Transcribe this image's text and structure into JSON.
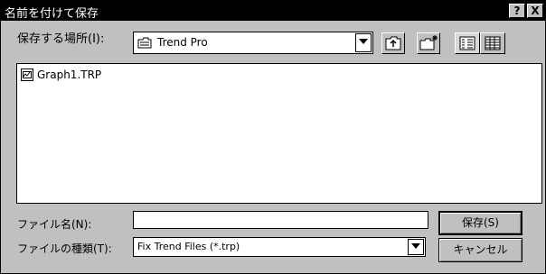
{
  "dialog": {
    "title": "名前を付けて保存",
    "help_label": "?",
    "close_label": "X"
  },
  "lookin": {
    "label": "保存する場所(I):",
    "value": "Trend Pro"
  },
  "toolbar": {
    "icons": [
      "up-one-level-icon",
      "create-new-folder-icon",
      "list-view-icon",
      "details-view-icon"
    ]
  },
  "files": [
    {
      "name": "Graph1.TRP",
      "icon": "trp-file-icon"
    }
  ],
  "filename": {
    "label": "ファイル名(N):",
    "value": ""
  },
  "filetype": {
    "label": "ファイルの種類(T):",
    "value": "Fix Trend Files (*.trp)"
  },
  "buttons": {
    "save_label": "保存(S)",
    "cancel_label": "キャンセル"
  }
}
